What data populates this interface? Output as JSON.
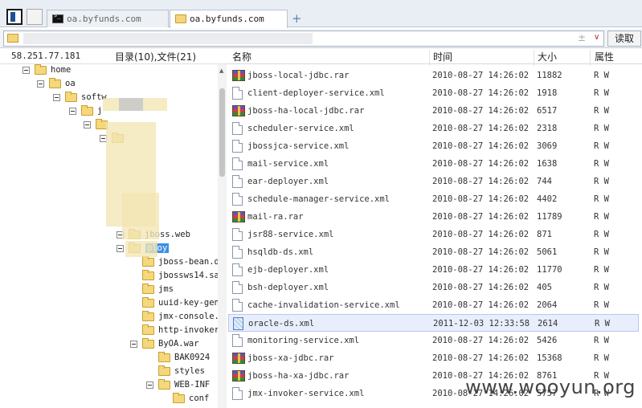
{
  "tabs": [
    {
      "label": "oa.byfunds.com",
      "icon": "terminal-icon"
    },
    {
      "label": "oa.byfunds.com",
      "icon": "folder-icon"
    }
  ],
  "address": {
    "toggle_symbol": "±",
    "dropdown_symbol": "∨",
    "read_label": "读取"
  },
  "left_panel": {
    "ip": "58.251.77.181",
    "counts": "目录(10),文件(21)",
    "tree": [
      {
        "label": "home"
      },
      {
        "label": "oa"
      },
      {
        "label": "softw"
      },
      {
        "label": "j"
      },
      {
        "label": ""
      },
      {
        "label": ""
      },
      {
        "label": "jboss.web"
      },
      {
        "label": "ploy"
      },
      {
        "label": "jboss-bean.d"
      },
      {
        "label": "jbossws14.sa"
      },
      {
        "label": "jms"
      },
      {
        "label": "uuid-key-gen"
      },
      {
        "label": "jmx-console.:"
      },
      {
        "label": "http-invoker"
      },
      {
        "label": "ByOA.war"
      },
      {
        "label": "BAK0924"
      },
      {
        "label": "styles"
      },
      {
        "label": "WEB-INF"
      },
      {
        "label": "conf"
      }
    ]
  },
  "columns": {
    "name": "名称",
    "time": "时间",
    "size": "大小",
    "attr": "属性"
  },
  "files": [
    {
      "name": "jboss-local-jdbc.rar",
      "time": "2010-08-27 14:26:02",
      "size": "11882",
      "attr": "R W",
      "type": "rar"
    },
    {
      "name": "client-deployer-service.xml",
      "time": "2010-08-27 14:26:02",
      "size": "1918",
      "attr": "R W",
      "type": "xml"
    },
    {
      "name": "jboss-ha-local-jdbc.rar",
      "time": "2010-08-27 14:26:02",
      "size": "6517",
      "attr": "R W",
      "type": "rar"
    },
    {
      "name": "scheduler-service.xml",
      "time": "2010-08-27 14:26:02",
      "size": "2318",
      "attr": "R W",
      "type": "xml"
    },
    {
      "name": "jbossjca-service.xml",
      "time": "2010-08-27 14:26:02",
      "size": "3069",
      "attr": "R W",
      "type": "xml"
    },
    {
      "name": "mail-service.xml",
      "time": "2010-08-27 14:26:02",
      "size": "1638",
      "attr": "R W",
      "type": "xml"
    },
    {
      "name": "ear-deployer.xml",
      "time": "2010-08-27 14:26:02",
      "size": "744",
      "attr": "R W",
      "type": "xml"
    },
    {
      "name": "schedule-manager-service.xml",
      "time": "2010-08-27 14:26:02",
      "size": "4402",
      "attr": "R W",
      "type": "xml"
    },
    {
      "name": "mail-ra.rar",
      "time": "2010-08-27 14:26:02",
      "size": "11789",
      "attr": "R W",
      "type": "rar"
    },
    {
      "name": "jsr88-service.xml",
      "time": "2010-08-27 14:26:02",
      "size": "871",
      "attr": "R W",
      "type": "xml"
    },
    {
      "name": "hsqldb-ds.xml",
      "time": "2010-08-27 14:26:02",
      "size": "5061",
      "attr": "R W",
      "type": "xml"
    },
    {
      "name": "ejb-deployer.xml",
      "time": "2010-08-27 14:26:02",
      "size": "11770",
      "attr": "R W",
      "type": "xml"
    },
    {
      "name": "bsh-deployer.xml",
      "time": "2010-08-27 14:26:02",
      "size": "405",
      "attr": "R W",
      "type": "xml"
    },
    {
      "name": "cache-invalidation-service.xml",
      "time": "2010-08-27 14:26:02",
      "size": "2064",
      "attr": "R W",
      "type": "xml"
    },
    {
      "name": "oracle-ds.xml",
      "time": "2011-12-03 12:33:58",
      "size": "2614",
      "attr": "R W",
      "type": "hl"
    },
    {
      "name": "monitoring-service.xml",
      "time": "2010-08-27 14:26:02",
      "size": "5426",
      "attr": "R W",
      "type": "xml"
    },
    {
      "name": "jboss-xa-jdbc.rar",
      "time": "2010-08-27 14:26:02",
      "size": "15368",
      "attr": "R W",
      "type": "rar"
    },
    {
      "name": "jboss-ha-xa-jdbc.rar",
      "time": "2010-08-27 14:26:02",
      "size": "8761",
      "attr": "R W",
      "type": "rar"
    },
    {
      "name": "jmx-invoker-service.xml",
      "time": "2010-08-27 14:26:02",
      "size": "5757",
      "attr": "R W",
      "type": "xml"
    }
  ],
  "watermark": "www.wooyun.org"
}
